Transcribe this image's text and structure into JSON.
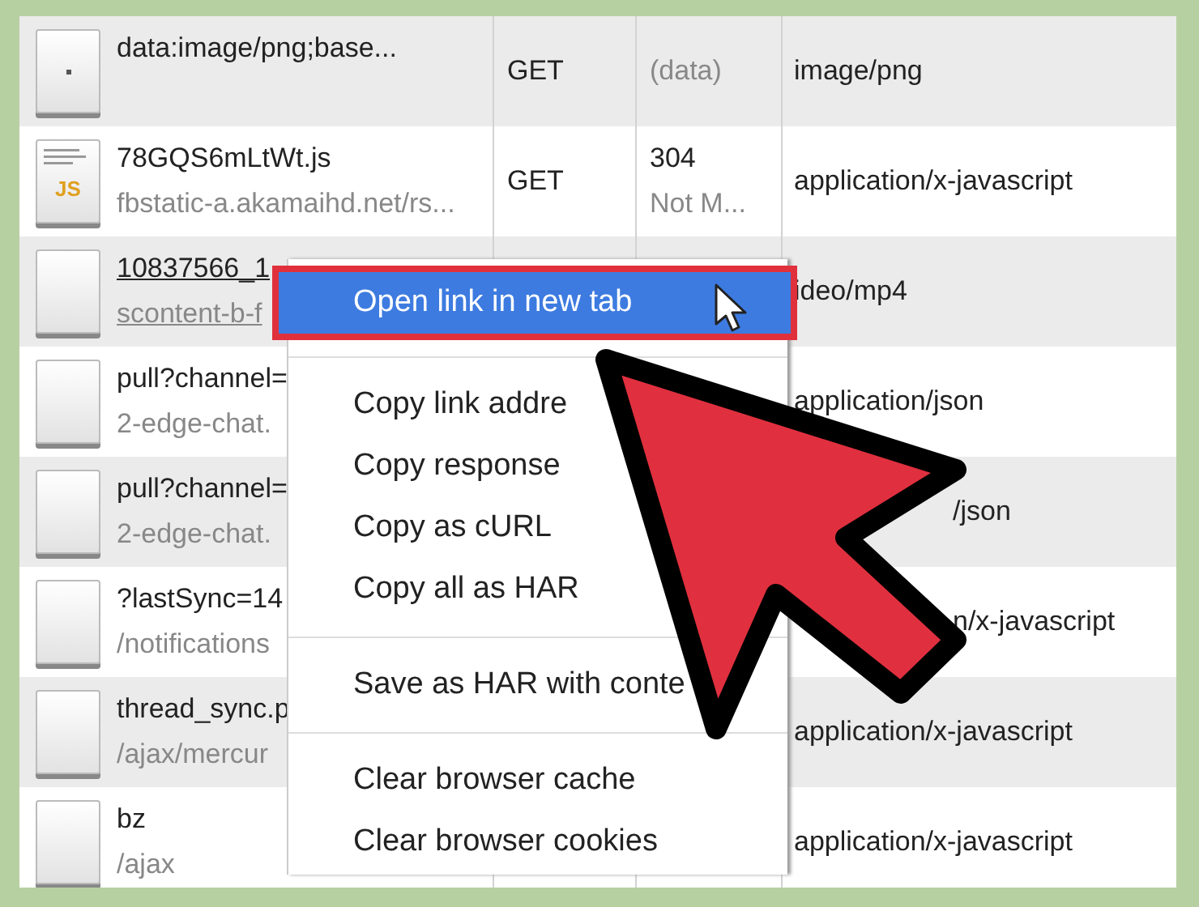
{
  "requests": [
    {
      "kind": "image",
      "name": "data:image/png;base...",
      "method": "GET",
      "status": "(data)",
      "status_dim": true,
      "type": "image/png",
      "hovered": false
    },
    {
      "kind": "script",
      "badge": "JS",
      "name": "78GQS6mLtWt.js",
      "domain": "fbstatic-a.akamaihd.net/rs...",
      "method": "GET",
      "status": "304",
      "status_dim": false,
      "status_text": "Not M...",
      "type": "application/x-javascript",
      "hovered": false
    },
    {
      "kind": "blank",
      "name": "10837566_1",
      "domain": "scontent-b-f",
      "type": "ideo/mp4",
      "hovered": true
    },
    {
      "kind": "blank",
      "name": "pull?channel=",
      "domain": "2-edge-chat.",
      "type": "application/json",
      "hovered": false
    },
    {
      "kind": "blank",
      "name": "pull?channel=",
      "domain": "2-edge-chat.",
      "type": "/json",
      "type_covered": true,
      "hovered": false
    },
    {
      "kind": "blank",
      "name": "?lastSync=14",
      "domain": "/notifications",
      "type": "n/x-javascript",
      "type_covered": true,
      "hovered": false
    },
    {
      "kind": "blank",
      "name": "thread_sync.p",
      "domain": "/ajax/mercur",
      "type": "application/x-javascript",
      "hovered": false
    },
    {
      "kind": "blank",
      "name": "bz",
      "domain": "/ajax",
      "type": "application/x-javascript",
      "hovered": false
    }
  ],
  "context_menu": [
    {
      "kind": "item",
      "label": "Open link in new tab",
      "selected": true
    },
    {
      "kind": "divider"
    },
    {
      "kind": "item",
      "label": "Copy link addre",
      "selected": false
    },
    {
      "kind": "item",
      "label": "Copy response",
      "selected": false
    },
    {
      "kind": "item",
      "label": "Copy as cURL",
      "selected": false
    },
    {
      "kind": "item",
      "label": "Copy all as HAR",
      "selected": false
    },
    {
      "kind": "divider"
    },
    {
      "kind": "item",
      "label": "Save as HAR with conte",
      "selected": false
    },
    {
      "kind": "divider"
    },
    {
      "kind": "item",
      "label": "Clear browser cache",
      "selected": false
    },
    {
      "kind": "item",
      "label": "Clear browser cookies",
      "selected": false
    },
    {
      "kind": "divider"
    }
  ]
}
